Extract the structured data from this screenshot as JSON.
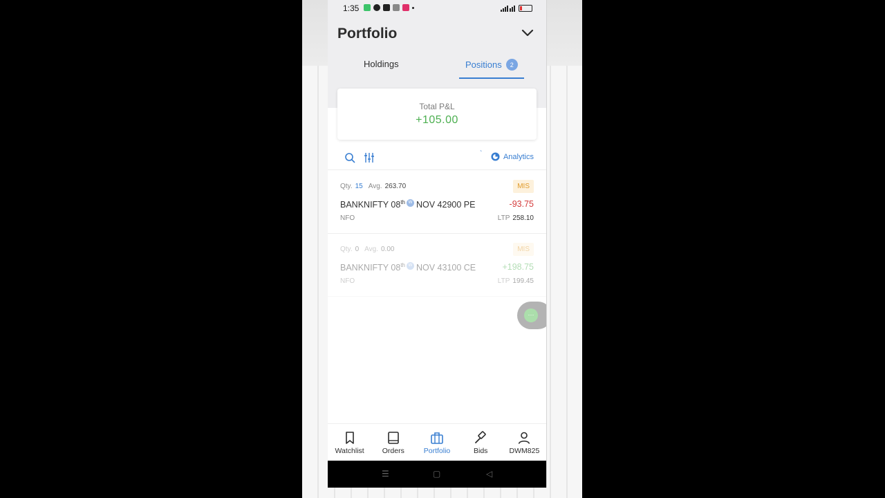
{
  "status": {
    "time": "1:35"
  },
  "header": {
    "title": "Portfolio"
  },
  "tabs": {
    "holdings": "Holdings",
    "positions": "Positions",
    "positions_count": "2"
  },
  "pnl": {
    "label": "Total P&L",
    "value": "+105.00"
  },
  "toolbar": {
    "analytics": "Analytics"
  },
  "positions": [
    {
      "qty_label": "Qty.",
      "qty": "15",
      "avg_label": "Avg.",
      "avg": "263.70",
      "product": "MIS",
      "symbol": "BANKNIFTY 08",
      "sup": "th",
      "weekly": "W",
      "contract": "NOV 42900 PE",
      "pnl": "-93.75",
      "exchange": "NFO",
      "ltp_label": "LTP",
      "ltp": "258.10"
    },
    {
      "qty_label": "Qty.",
      "qty": "0",
      "avg_label": "Avg.",
      "avg": "0.00",
      "product": "MIS",
      "symbol": "BANKNIFTY 08",
      "sup": "th",
      "weekly": "W",
      "contract": "NOV 43100 CE",
      "pnl": "+198.75",
      "exchange": "NFO",
      "ltp_label": "LTP",
      "ltp": "199.45"
    }
  ],
  "fab": {
    "label": "···"
  },
  "nav": [
    {
      "label": "Watchlist",
      "icon": "bookmark-icon"
    },
    {
      "label": "Orders",
      "icon": "book-icon"
    },
    {
      "label": "Portfolio",
      "icon": "briefcase-icon"
    },
    {
      "label": "Bids",
      "icon": "gavel-icon"
    },
    {
      "label": "DWM825",
      "icon": "user-icon"
    }
  ],
  "colors": {
    "accent": "#387ed1",
    "profit": "#4caf50",
    "loss": "#d43b3b",
    "mis_bg": "#fdf1dc",
    "mis_text": "#e09a2a"
  }
}
